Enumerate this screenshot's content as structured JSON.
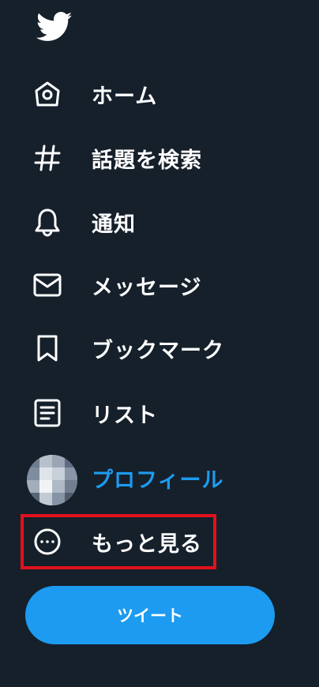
{
  "brand": {
    "logo_icon": "twitter-bird-icon",
    "color": "#ffffff"
  },
  "nav": {
    "items": [
      {
        "label": "ホーム",
        "icon": "home-icon"
      },
      {
        "label": "話題を検索",
        "icon": "hashtag-icon"
      },
      {
        "label": "通知",
        "icon": "bell-icon"
      },
      {
        "label": "メッセージ",
        "icon": "envelope-icon"
      },
      {
        "label": "ブックマーク",
        "icon": "bookmark-icon"
      },
      {
        "label": "リスト",
        "icon": "list-icon"
      },
      {
        "label": "プロフィール",
        "icon": "avatar",
        "active": true
      },
      {
        "label": "もっと見る",
        "icon": "more-circle-icon",
        "highlighted": true
      }
    ]
  },
  "tweet_button": {
    "label": "ツイート"
  },
  "colors": {
    "background": "#15202b",
    "accent": "#1d9bf0",
    "text": "#ffffff",
    "highlight": "#e3101d"
  }
}
